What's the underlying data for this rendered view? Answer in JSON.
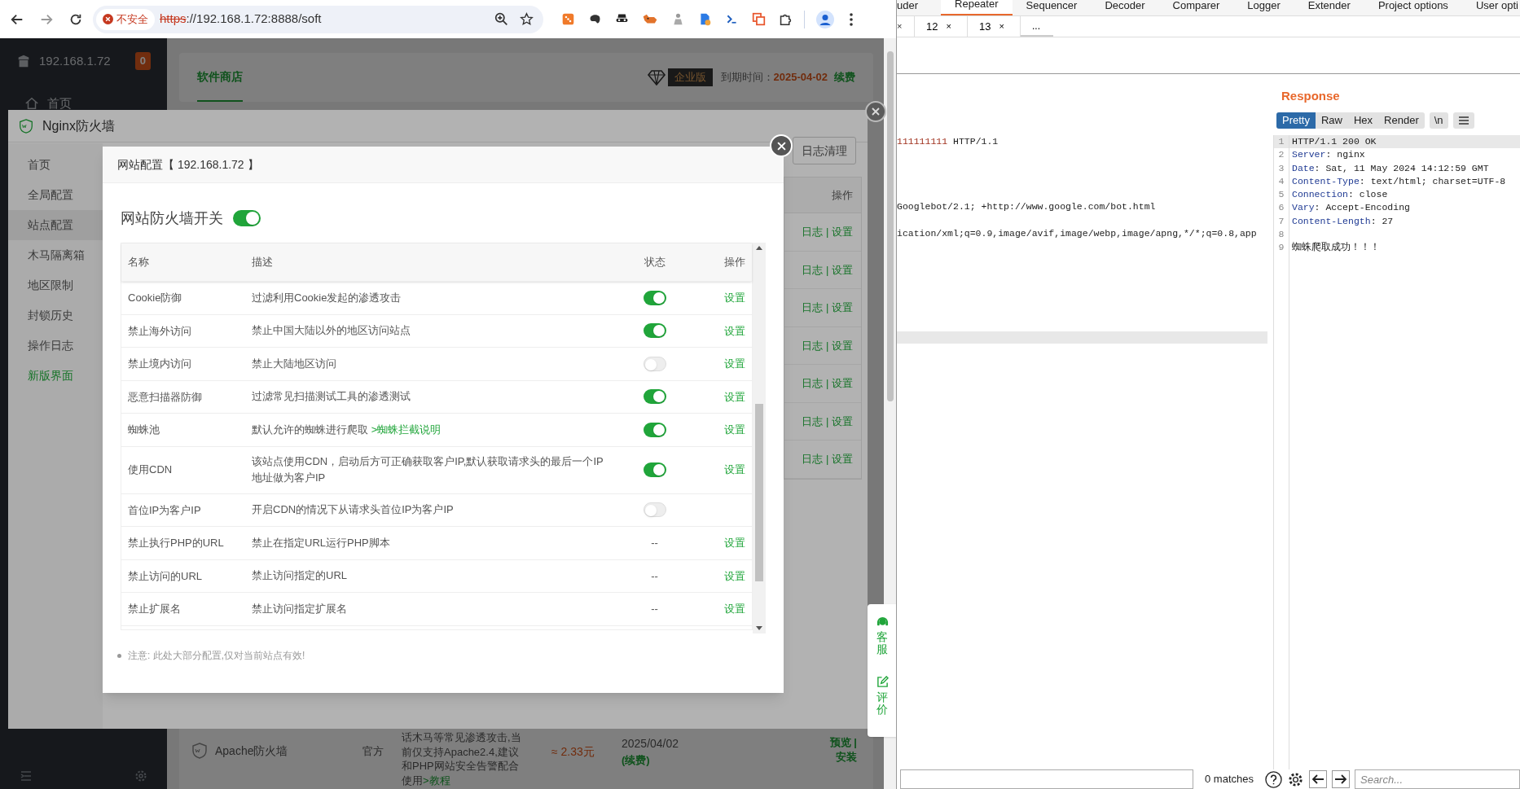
{
  "browser": {
    "security_label": "不安全",
    "url_scheme": "https",
    "url_rest": "://192.168.1.72:8888/soft"
  },
  "panel": {
    "host": "192.168.1.72",
    "badge": "0",
    "nav_home": "首页",
    "tab": "软件商店",
    "edition": "企业版",
    "expiry_label": "到期时间：",
    "expiry_date": "2025-04-02",
    "renew": "续费"
  },
  "plugin_row": {
    "name": "Apache防火墙",
    "source": "官方",
    "description": "话木马等常见渗透攻击,当前仅支持Apache2.4,建议和PHP网站安全告警配合使用",
    "tutorial_link": ">教程",
    "price": "≈ 2.33元",
    "expiry": "2025/04/02",
    "renew": "(续费)",
    "actions": "预览 | 安装"
  },
  "float_widget": [
    {
      "kind": "service",
      "label": "客服"
    },
    {
      "kind": "review",
      "label": "评价"
    }
  ],
  "waf_window": {
    "title": "Nginx防火墙",
    "menu": [
      {
        "label": "首页",
        "kind": "page",
        "selected": false
      },
      {
        "label": "全局配置",
        "kind": "page",
        "selected": false
      },
      {
        "label": "站点配置",
        "kind": "page",
        "selected": true
      },
      {
        "label": "木马隔离箱",
        "kind": "page",
        "selected": false
      },
      {
        "label": "地区限制",
        "kind": "page",
        "selected": false
      },
      {
        "label": "封锁历史",
        "kind": "page",
        "selected": false
      },
      {
        "label": "操作日志",
        "kind": "page",
        "selected": false
      },
      {
        "label": "新版界面",
        "kind": "link",
        "selected": false
      }
    ],
    "clear_button": "日志清理",
    "column_header": "操作",
    "row_actions": [
      "日志 | 设置",
      "日志 | 设置",
      "日志 | 设置",
      "日志 | 设置",
      "日志 | 设置",
      "日志 | 设置",
      "日志 | 设置"
    ]
  },
  "site_dialog": {
    "title": "网站配置【 192.168.1.72 】",
    "master_switch": {
      "label": "网站防火墙开关",
      "on": true
    },
    "columns": [
      "名称",
      "描述",
      "状态",
      "操作"
    ],
    "rows": [
      {
        "kind": "switch",
        "name": "Cookie防御",
        "description": "过滤利用Cookie发起的渗透攻击",
        "on": true,
        "action": "设置"
      },
      {
        "kind": "switch",
        "name": "禁止海外访问",
        "description": "禁止中国大陆以外的地区访问站点",
        "on": true,
        "action": "设置"
      },
      {
        "kind": "switch",
        "name": "禁止境内访问",
        "description": "禁止大陆地区访问",
        "on": false,
        "action": "设置"
      },
      {
        "kind": "switch",
        "name": "恶意扫描器防御",
        "description": "过滤常见扫描测试工具的渗透测试",
        "on": true,
        "action": "设置"
      },
      {
        "kind": "switch",
        "name": "蜘蛛池",
        "description": "默认允许的蜘蛛进行爬取",
        "link": ">蜘蛛拦截说明",
        "on": true,
        "action": "设置"
      },
      {
        "kind": "switch",
        "name": "使用CDN",
        "description": "该站点使用CDN，启动后方可正确获取客户IP,默认获取请求头的最后一个IP地址做为客户IP",
        "on": true,
        "action": "设置"
      },
      {
        "kind": "switch",
        "name": "首位IP为客户IP",
        "description": "开启CDN的情况下从请求头首位IP为客户IP",
        "on": false
      },
      {
        "kind": "text",
        "name": "禁止执行PHP的URL",
        "description": "禁止在指定URL运行PHP脚本",
        "status": "--",
        "action": "设置"
      },
      {
        "kind": "text",
        "name": "禁止访问的URL",
        "description": "禁止访问指定的URL",
        "status": "--",
        "action": "设置"
      },
      {
        "kind": "text",
        "name": "禁止扩展名",
        "description": "禁止访问指定扩展名",
        "status": "--",
        "action": "设置"
      }
    ],
    "note": "注意: 此处大部分配置,仅对当前站点有效!"
  },
  "burp": {
    "tools": [
      {
        "label": "uder",
        "selected": false
      },
      {
        "label": "Repeater",
        "selected": true
      },
      {
        "label": "Sequencer",
        "selected": false
      },
      {
        "label": "Decoder",
        "selected": false
      },
      {
        "label": "Comparer",
        "selected": false
      },
      {
        "label": "Logger",
        "selected": false
      },
      {
        "label": "Extender",
        "selected": false
      },
      {
        "label": "Project options",
        "selected": false
      },
      {
        "label": "User opti",
        "selected": false
      }
    ],
    "request_tabs": [
      {
        "kind": "cut",
        "close": "×"
      },
      {
        "kind": "tab",
        "label": "12",
        "close": "×"
      },
      {
        "kind": "tab",
        "label": "13",
        "close": "×"
      },
      {
        "kind": "more",
        "label": "..."
      }
    ],
    "request_lines": [
      {
        "segments": [
          {
            "kind": "param",
            "text": "111111111"
          },
          {
            "kind": "plain",
            "text": " HTTP/1.1"
          }
        ]
      },
      {
        "segments": [
          {
            "kind": "plain",
            "text": " Googlebot/2.1; +http://www.google.com/bot.html"
          }
        ]
      },
      {
        "segments": [
          {
            "kind": "plain",
            "text": "ication/xml;q=0.9,image/avif,image/webp,image/apng,*/*;q=0.8,app"
          }
        ]
      }
    ],
    "response": {
      "title": "Response",
      "views": [
        {
          "label": "Pretty",
          "selected": true
        },
        {
          "label": "Raw",
          "selected": false
        },
        {
          "label": "Hex",
          "selected": false
        },
        {
          "label": "Render",
          "selected": false
        }
      ],
      "newline_button": "\\n",
      "lines": [
        {
          "number": "1",
          "text": "HTTP/1.1 200 OK",
          "selected": true
        },
        {
          "number": "2",
          "key": "Server",
          "text": ": nginx",
          "selected": false
        },
        {
          "number": "3",
          "key": "Date",
          "text": ": Sat, 11 May 2024 14:12:59 GMT",
          "selected": false
        },
        {
          "number": "4",
          "key": "Content-Type",
          "text": ": text/html; charset=UTF-8",
          "selected": false
        },
        {
          "number": "5",
          "key": "Connection",
          "text": ": close",
          "selected": false
        },
        {
          "number": "6",
          "key": "Vary",
          "text": ": Accept-Encoding",
          "selected": false
        },
        {
          "number": "7",
          "key": "Content-Length",
          "text": ": 27",
          "selected": false
        },
        {
          "number": "8",
          "selected": false
        },
        {
          "number": "9",
          "text": "蜘蛛爬取成功！！！",
          "selected": false
        }
      ]
    },
    "matches": "0 matches",
    "search_placeholder": "Search..."
  }
}
